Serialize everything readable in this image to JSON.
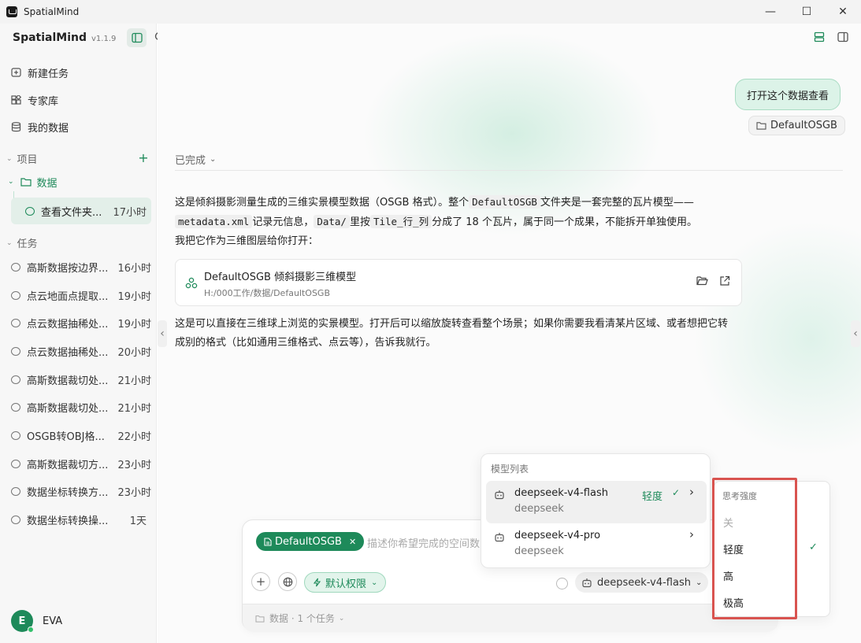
{
  "window": {
    "title": "SpatialMind",
    "minimize": "—",
    "maximize": "☐",
    "close": "✕"
  },
  "sidebar": {
    "brand": "SpatialMind",
    "version": "v1.1.9",
    "nav": [
      {
        "label": "新建任务"
      },
      {
        "label": "专家库"
      },
      {
        "label": "我的数据"
      }
    ],
    "projects_label": "项目",
    "folder": "数据",
    "active_task": {
      "name": "查看文件夹...",
      "time": "17小时"
    },
    "tasks_label": "任务",
    "tasks": [
      {
        "name": "高斯数据按边界...",
        "time": "16小时"
      },
      {
        "name": "点云地面点提取...",
        "time": "19小时"
      },
      {
        "name": "点云数据抽稀处...",
        "time": "19小时"
      },
      {
        "name": "点云数据抽稀处...",
        "time": "20小时"
      },
      {
        "name": "高斯数据裁切处...",
        "time": "21小时"
      },
      {
        "name": "高斯数据裁切处...",
        "time": "21小时"
      },
      {
        "name": "OSGB转OBJ格...",
        "time": "22小时"
      },
      {
        "name": "高斯数据裁切方...",
        "time": "23小时"
      },
      {
        "name": "数据坐标转换方...",
        "time": "23小时"
      },
      {
        "name": "数据坐标转换操...",
        "time": "1天"
      }
    ],
    "user": {
      "initial": "E",
      "name": "EVA"
    }
  },
  "chat": {
    "user_message": "打开这个数据查看",
    "user_attachment": "DefaultOSGB",
    "status": "已完成",
    "para1": {
      "t1": "这是倾斜摄影测量生成的三维实景模型数据（OSGB 格式）。整个",
      "c1": "DefaultOSGB",
      "t2": "文件夹是一套完整的瓦片模型——",
      "c2": "metadata.xml",
      "t3": "记录元信息，",
      "c3": "Data/",
      "t4": "里按",
      "c4": "Tile_行_列",
      "t5": "分成了 18 个瓦片，属于同一个成果，不能拆开单独使用。",
      "t6": "我把它作为三维图层给你打开："
    },
    "file_card": {
      "title": "DefaultOSGB 倾斜摄影三维模型",
      "path": "H:/000工作/数据/DefaultOSGB"
    },
    "para2": "这是可以直接在三维球上浏览的实景模型。打开后可以缩放旋转查看整个场景；如果你需要我看清某片区域、或者想把它转成别的格式（比如通用三维格式、点云等），告诉我就行。"
  },
  "composer": {
    "tag": "DefaultOSGB",
    "placeholder": "描述你希望完成的空间数",
    "permission": "默认权限",
    "model": "deepseek-v4-flash",
    "footer": "数据 · 1 个任务"
  },
  "model_menu": {
    "title": "模型列表",
    "items": [
      {
        "name": "deepseek-v4-flash",
        "provider": "deepseek",
        "level": "轻度"
      },
      {
        "name": "deepseek-v4-pro",
        "provider": "deepseek"
      }
    ]
  },
  "think_menu": {
    "title": "思考强度",
    "options": [
      {
        "label": "关"
      },
      {
        "label": "轻度"
      },
      {
        "label": "高"
      },
      {
        "label": "极高"
      }
    ]
  },
  "colors": {
    "accent": "#1e8a5a",
    "highlight_outline": "#d9534f"
  }
}
